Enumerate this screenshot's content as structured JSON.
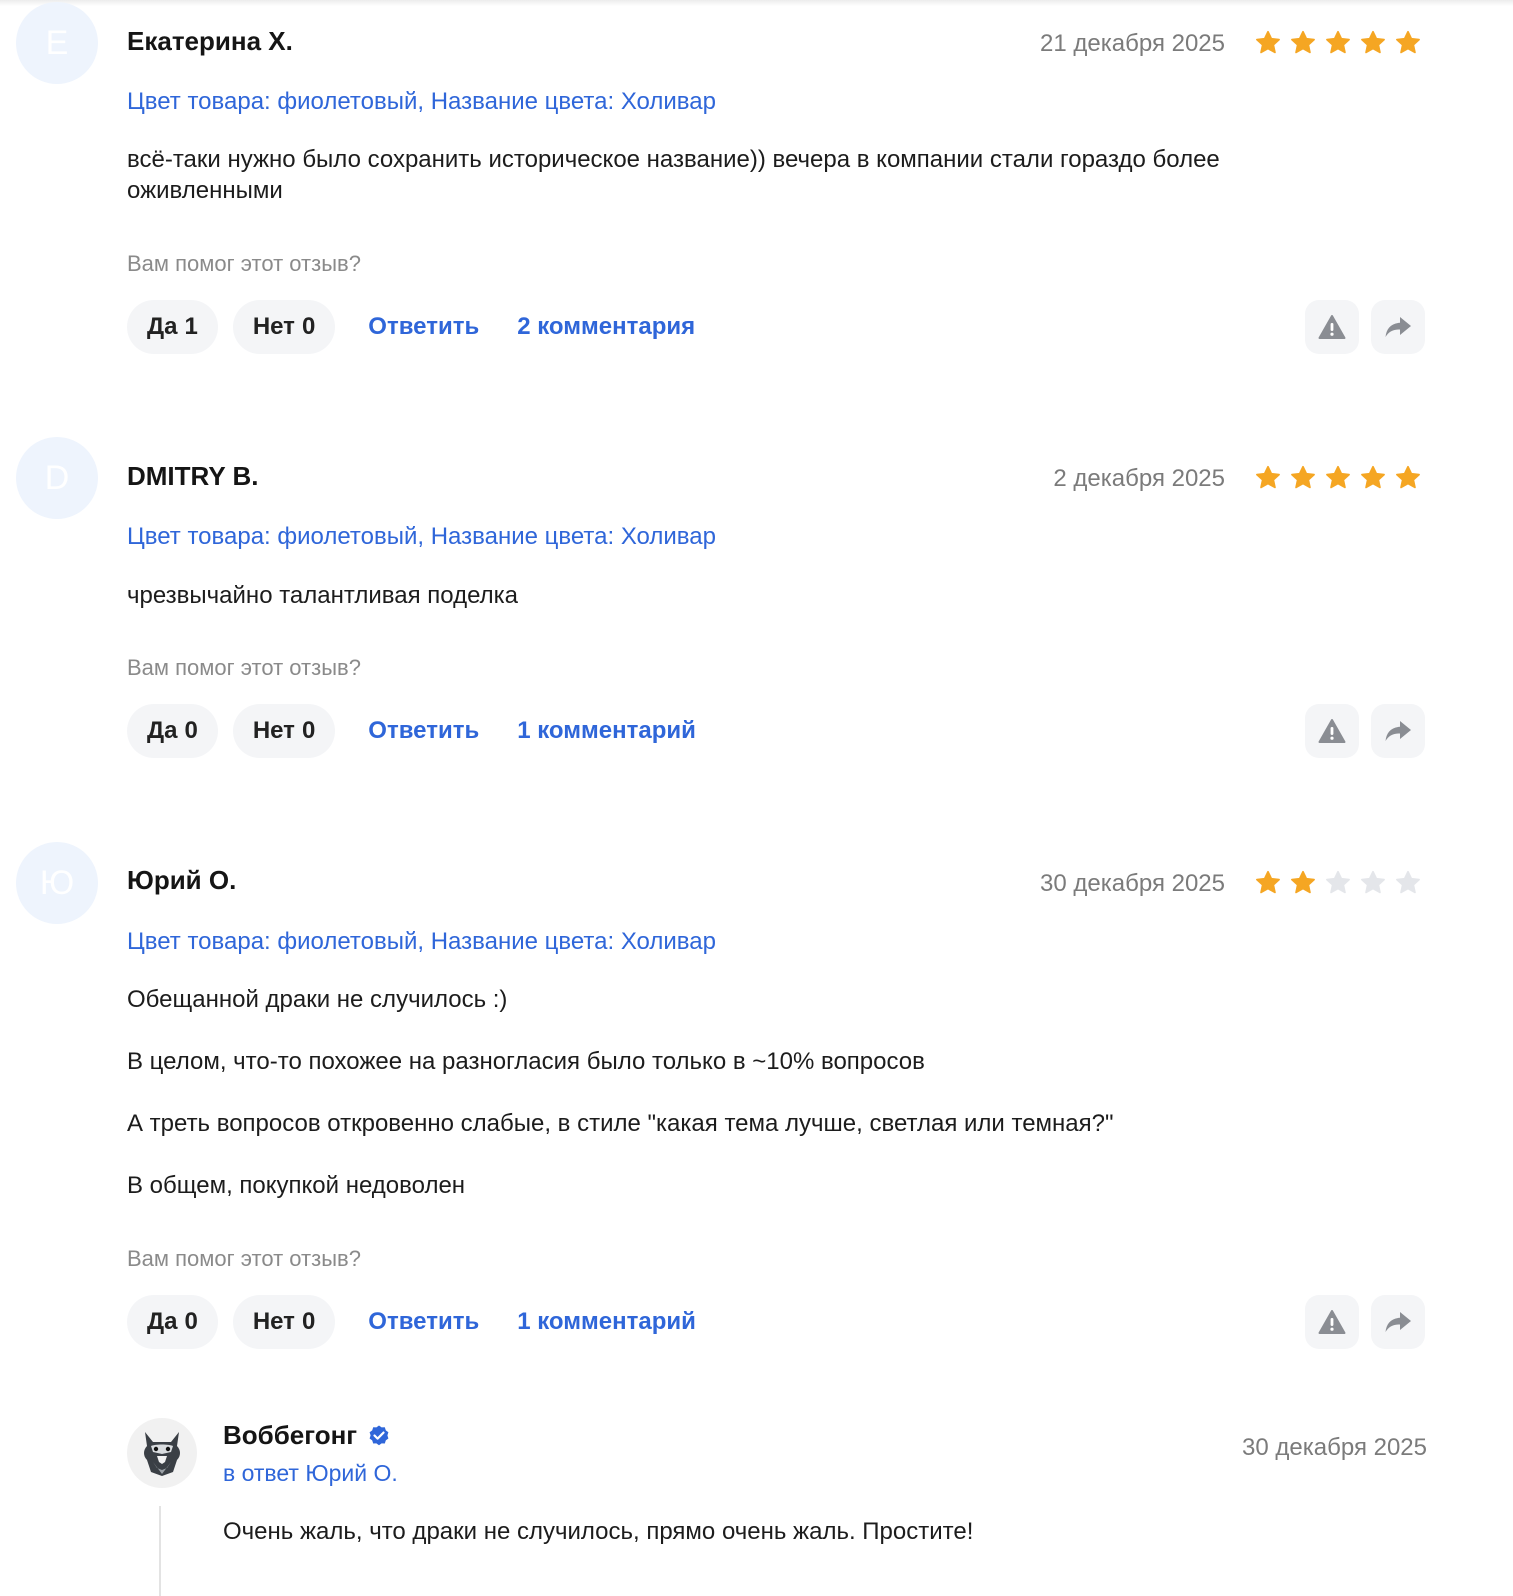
{
  "colors": {
    "accent": "#2f66d9",
    "star_filled": "#f5a623",
    "star_empty": "#e4e6ea",
    "avatar_bg": "#eef4fd",
    "button_bg": "#f4f5f7"
  },
  "reviews": [
    {
      "avatar_letter": "Е",
      "author": "Екатерина Х.",
      "date": "21 декабря 2025",
      "rating": 5,
      "variant": "Цвет товара: фиолетовый, Название цвета: Холивар",
      "paragraphs": [
        "всё-таки нужно было сохранить историческое название)) вечера в компании стали гораздо более оживленными"
      ],
      "helpful_question": "Вам помог этот отзыв?",
      "yes_label": "Да",
      "yes_count": "1",
      "no_label": "Нет",
      "no_count": "0",
      "reply_label": "Ответить",
      "comments_label": "2 комментария"
    },
    {
      "avatar_letter": "D",
      "author": "DMITRY B.",
      "date": "2 декабря 2025",
      "rating": 5,
      "variant": "Цвет товара: фиолетовый, Название цвета: Холивар",
      "paragraphs": [
        "чрезвычайно талантливая поделка"
      ],
      "helpful_question": "Вам помог этот отзыв?",
      "yes_label": "Да",
      "yes_count": "0",
      "no_label": "Нет",
      "no_count": "0",
      "reply_label": "Ответить",
      "comments_label": "1 комментарий"
    },
    {
      "avatar_letter": "Ю",
      "author": "Юрий О.",
      "date": "30 декабря 2025",
      "rating": 2,
      "variant": "Цвет товара: фиолетовый, Название цвета: Холивар",
      "paragraphs": [
        "Обещанной драки не случилось :)",
        "В целом, что-то похожее на разногласия было только в ~10% вопросов",
        "А треть вопросов откровенно слабые, в стиле \"какая тема лучше, светлая или темная?\"",
        "В общем, покупкой недоволен"
      ],
      "helpful_question": "Вам помог этот отзыв?",
      "yes_label": "Да",
      "yes_count": "0",
      "no_label": "Нет",
      "no_count": "0",
      "reply_label": "Ответить",
      "comments_label": "1 комментарий"
    }
  ],
  "seller_reply": {
    "name": "Воббегонг",
    "verified_icon": "verified-check-icon",
    "avatar_icon": "wolf-logo-icon",
    "reply_to": "в ответ Юрий О.",
    "date": "30 декабря 2025",
    "text": "Очень жаль, что драки не случилось, прямо очень жаль. Простите!"
  },
  "icons": {
    "report": "report-warning-icon",
    "share": "share-arrow-icon",
    "star": "star-icon"
  }
}
